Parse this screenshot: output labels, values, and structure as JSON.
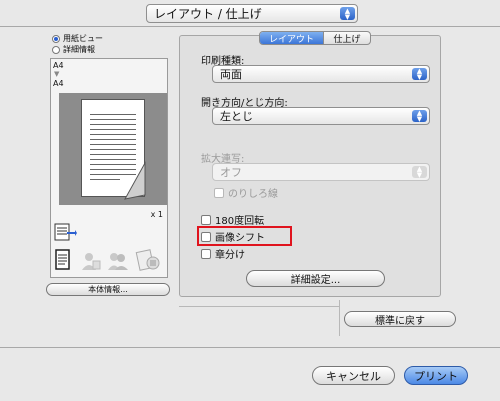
{
  "header": {
    "popup_label": "レイアウト / 仕上げ"
  },
  "preview": {
    "radio_paper_view": "用紙ビュー",
    "radio_detail_view": "詳細情報",
    "size_from": "A4",
    "size_to": "A4",
    "copies": "x 1",
    "device_info_button": "本体情報..."
  },
  "tabs": {
    "layout": "レイアウト",
    "finish": "仕上げ"
  },
  "form": {
    "print_type_label": "印刷種類:",
    "print_type_value": "両面",
    "binding_label": "開き方向/とじ方向:",
    "binding_value": "左とじ",
    "zoom_label": "拡大連写:",
    "zoom_value": "オフ",
    "margin_line": "のりしろ線",
    "rotate_180": "180度回転",
    "image_shift": "画像シフト",
    "chapter": "章分け",
    "details_button": "詳細設定..."
  },
  "footer": {
    "reset_button": "標準に戻す",
    "cancel_button": "キャンセル",
    "print_button": "プリント"
  },
  "colors": {
    "accent": "#3c76d8",
    "highlight": "#e0141e"
  }
}
